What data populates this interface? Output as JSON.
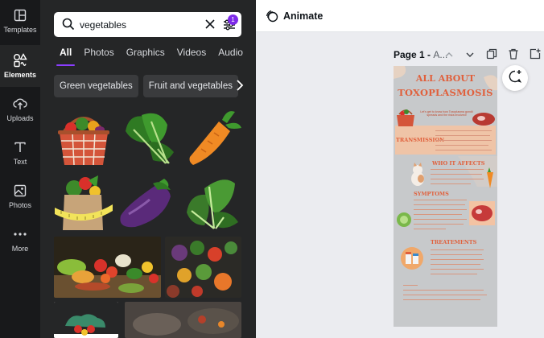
{
  "rail": {
    "items": [
      {
        "label": "Templates",
        "icon": "templates-icon"
      },
      {
        "label": "Elements",
        "icon": "elements-icon"
      },
      {
        "label": "Uploads",
        "icon": "uploads-icon"
      },
      {
        "label": "Text",
        "icon": "text-icon"
      },
      {
        "label": "Photos",
        "icon": "photos-icon"
      },
      {
        "label": "More",
        "icon": "more-icon"
      }
    ]
  },
  "search": {
    "value": "vegetables",
    "filter_badge": "1"
  },
  "tabs": [
    "All",
    "Photos",
    "Graphics",
    "Videos",
    "Audio"
  ],
  "chips": [
    "Green vegetables",
    "Fruit and vegetables"
  ],
  "topbar": {
    "animate_label": "Animate"
  },
  "page": {
    "label": "Page 1 - ",
    "sublabel": "A..."
  },
  "poster": {
    "title_line1": "ALL ABOUT",
    "title_line2": "TOXOPLASMOSIS",
    "intro": "Let's get to know how Toxoplasma gondii spreads and the risks involved!",
    "sections": [
      "TRANSMISSION",
      "WHO IT AFFECTS",
      "SYMPTOMS",
      "TREATEMENTS"
    ]
  },
  "colors": {
    "accent": "#8b3dff",
    "poster_orange": "#e0603c",
    "poster_bg": "#c7c9cb"
  }
}
